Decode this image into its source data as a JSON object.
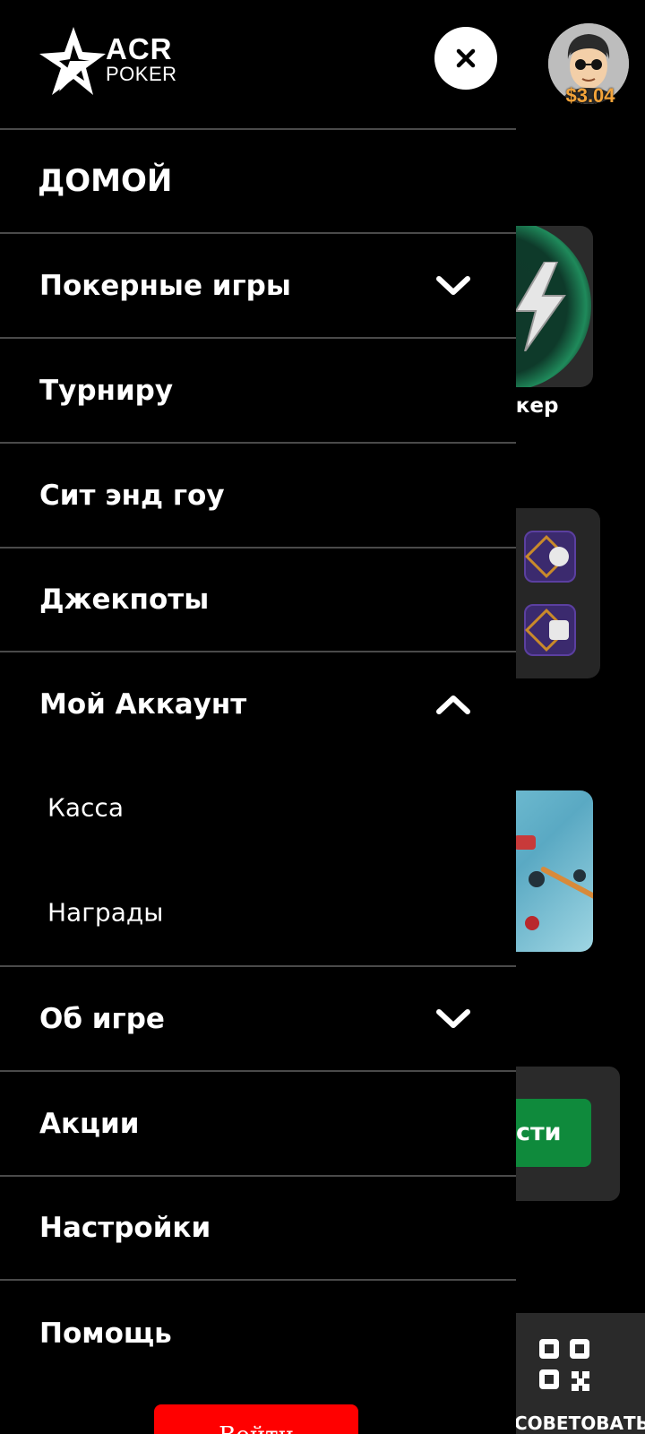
{
  "header": {
    "logo": {
      "line1": "ACR",
      "line2": "POKER",
      "icon": "star-logo-icon"
    },
    "close_icon": "close-icon",
    "avatar_icon": "user-avatar-icon",
    "balance": "$3.04",
    "balance_color": "#F2A33A"
  },
  "menu": {
    "items": [
      {
        "label": "ДОМОЙ"
      },
      {
        "label": "Покерные игры",
        "chevron": "chevron-down-icon"
      },
      {
        "label": "Турниру"
      },
      {
        "label": "Сит энд гоу"
      },
      {
        "label": "Джекпоты"
      },
      {
        "label": "Мой Аккаунт",
        "chevron": "chevron-up-icon",
        "expanded": true,
        "sub_items": [
          {
            "label": "Касса"
          },
          {
            "label": "Награды"
          }
        ]
      },
      {
        "label": "Об игре",
        "chevron": "chevron-down-icon"
      },
      {
        "label": "Акции"
      },
      {
        "label": "Настройки"
      },
      {
        "label": "Помощь"
      }
    ],
    "login_button": "Войти"
  },
  "background": {
    "game_label": "окер",
    "join_button": "сти",
    "share_label": "СОВЕТОВАТЬ",
    "share_icon": "qr-code-icon",
    "join_color": "#0F8A3C"
  },
  "colors": {
    "drawer_bg": "#000000",
    "divider": "#4A4A4A",
    "login_red": "#FF0000"
  }
}
